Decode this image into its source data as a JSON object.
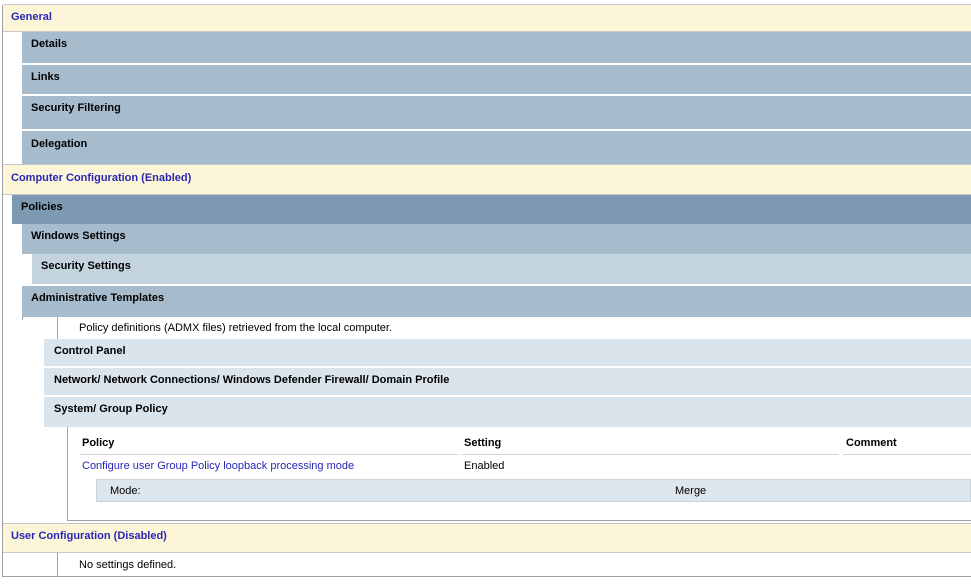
{
  "sections": {
    "general": {
      "title": "General",
      "items": [
        "Details",
        "Links",
        "Security Filtering",
        "Delegation"
      ]
    },
    "computer": {
      "title": "Computer Configuration (Enabled)",
      "policies": "Policies",
      "windows_settings": "Windows Settings",
      "security_settings": "Security Settings",
      "admin_templates": "Administrative Templates",
      "admx_note": "Policy definitions (ADMX files) retrieved from the local computer.",
      "control_panel": "Control Panel",
      "firewall_path": "Network/ Network Connections/ Windows Defender Firewall/ Domain Profile",
      "system_gp": "System/ Group Policy",
      "table": {
        "headers": {
          "policy": "Policy",
          "setting": "Setting",
          "comment": "Comment"
        },
        "row": {
          "policy": "Configure user Group Policy loopback processing mode",
          "setting": "Enabled",
          "comment": ""
        },
        "subrow": {
          "label": "Mode:",
          "value": "Merge"
        }
      }
    },
    "user": {
      "title": "User Configuration (Disabled)",
      "note": "No settings defined."
    }
  }
}
